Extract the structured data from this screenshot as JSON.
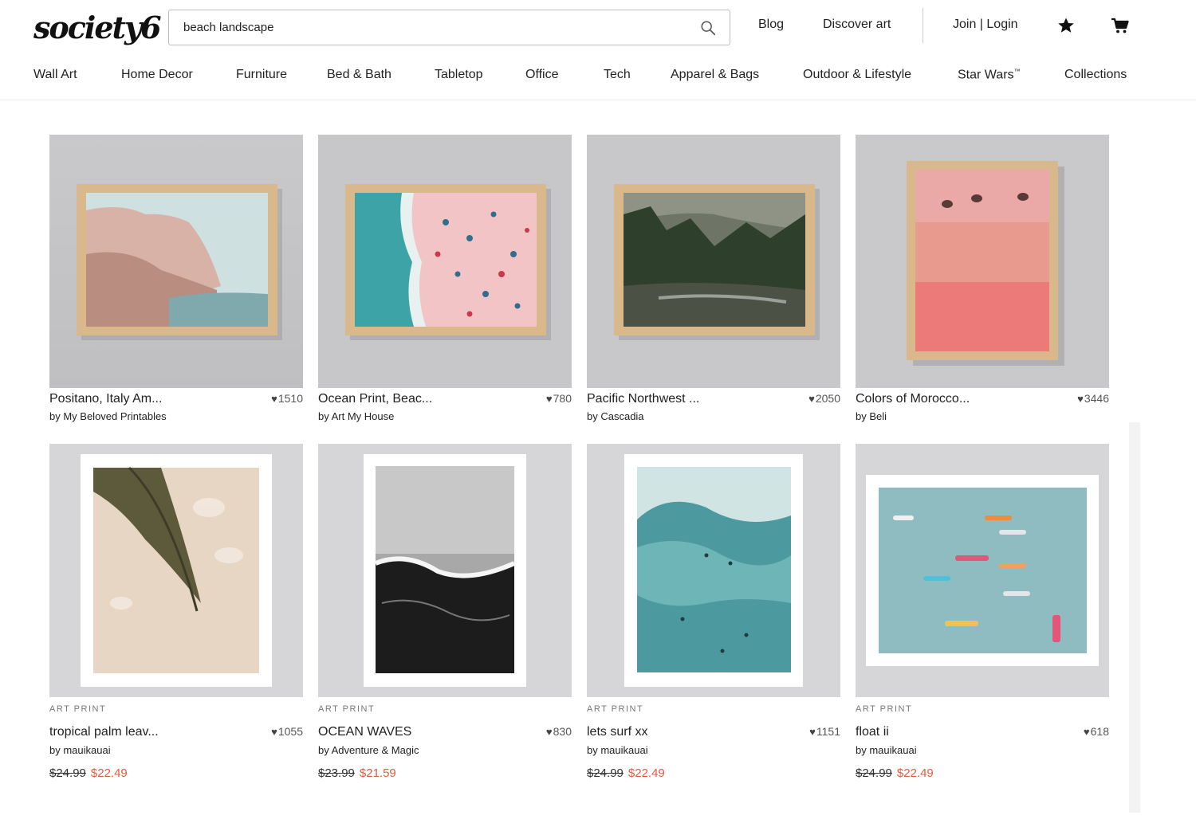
{
  "header": {
    "logo": "society6",
    "search": {
      "value": "beach landscape",
      "icon": "search-icon"
    },
    "links": {
      "blog": "Blog",
      "discover": "Discover art",
      "join_login": "Join | Login"
    },
    "icons": {
      "wishlist": "star-icon",
      "cart": "cart-icon"
    }
  },
  "nav": {
    "items": [
      "Wall Art",
      "Home Decor",
      "Furniture",
      "Bed & Bath",
      "Tabletop",
      "Office",
      "Tech",
      "Apparel & Bags",
      "Outdoor & Lifestyle",
      "Star Wars",
      "Collections"
    ],
    "tm_mark": "™"
  },
  "products_row1": [
    {
      "title": "Positano, Italy Am...",
      "likes": "1510",
      "artist": "by My Beloved Printables"
    },
    {
      "title": "Ocean Print, Beac...",
      "likes": "780",
      "artist": "by Art My House"
    },
    {
      "title": "Pacific Northwest ...",
      "likes": "2050",
      "artist": "by Cascadia"
    },
    {
      "title": "Colors of Morocco...",
      "likes": "3446",
      "artist": "by Beli"
    }
  ],
  "products_row2": [
    {
      "type": "ART PRINT",
      "title": "tropical palm leav...",
      "likes": "1055",
      "artist": "by mauikauai",
      "price_old": "$24.99",
      "price_new": "$22.49"
    },
    {
      "type": "ART PRINT",
      "title": "OCEAN WAVES",
      "likes": "830",
      "artist": "by Adventure & Magic",
      "price_old": "$23.99",
      "price_new": "$21.59"
    },
    {
      "type": "ART PRINT",
      "title": "lets surf xx",
      "likes": "1151",
      "artist": "by mauikauai",
      "price_old": "$24.99",
      "price_new": "$22.49"
    },
    {
      "type": "ART PRINT",
      "title": "float ii",
      "likes": "618",
      "artist": "by mauikauai",
      "price_old": "$24.99",
      "price_new": "$22.49"
    }
  ],
  "colors": {
    "sale_price": "#e25b3d",
    "frame_wood": "#d9b88c"
  }
}
